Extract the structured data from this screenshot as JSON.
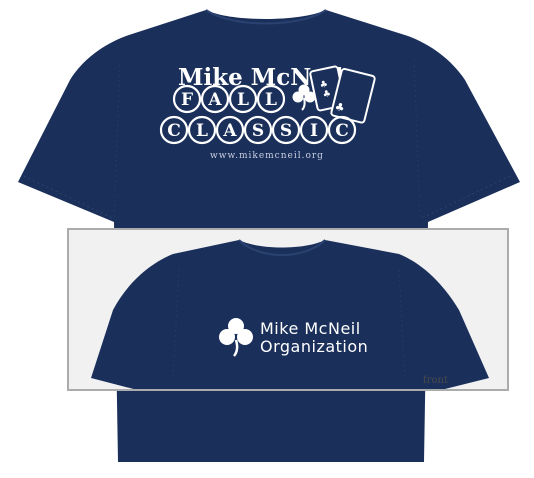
{
  "back": {
    "title": "Mike McNeil",
    "row1": [
      "F",
      "A",
      "L",
      "L"
    ],
    "row2": [
      "C",
      "L",
      "A",
      "S",
      "S",
      "I",
      "C"
    ],
    "url": "www.mikemcneil.org"
  },
  "front": {
    "org_line1": "Mike McNeil",
    "org_line2": "Organization",
    "label": "front"
  },
  "colors": {
    "shirt": "#1a2f5a",
    "print": "#ffffff",
    "inset_bg": "#f1f1f2",
    "inset_border": "#a9abad"
  },
  "icons": [
    "shamrock-icon",
    "playing-cards-icon"
  ]
}
